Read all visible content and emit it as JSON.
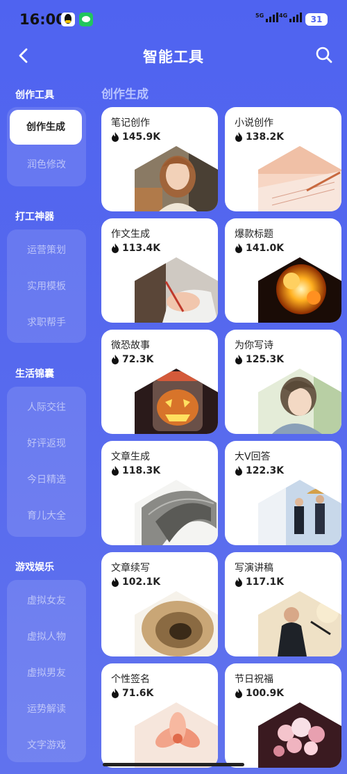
{
  "status": {
    "time": "16:00",
    "sig1_label": "5G",
    "sig2_label": "4G",
    "battery": "31"
  },
  "header": {
    "title": "智能工具"
  },
  "sidebar": {
    "sections": [
      {
        "title": "创作工具",
        "items": [
          "创作生成",
          "润色修改"
        ],
        "active": 0
      },
      {
        "title": "打工神器",
        "items": [
          "运营策划",
          "实用模板",
          "求职帮手"
        ]
      },
      {
        "title": "生活锦囊",
        "items": [
          "人际交往",
          "好评返现",
          "今日精选",
          "育儿大全"
        ]
      },
      {
        "title": "游戏娱乐",
        "items": [
          "虚拟女友",
          "虚拟人物",
          "虚拟男友",
          "运势解读",
          "文字游戏"
        ]
      }
    ]
  },
  "main": {
    "title": "创作生成",
    "cards": [
      {
        "title": "笔记创作",
        "count": "145.9K",
        "image": "portrait-woman"
      },
      {
        "title": "小说创作",
        "count": "138.2K",
        "image": "paper-pen"
      },
      {
        "title": "作文生成",
        "count": "113.4K",
        "image": "hand-writing"
      },
      {
        "title": "爆款标题",
        "count": "141.0K",
        "image": "explosion"
      },
      {
        "title": "微恐故事",
        "count": "72.3K",
        "image": "pumpkin-lantern"
      },
      {
        "title": "为你写诗",
        "count": "125.3K",
        "image": "anime-poet"
      },
      {
        "title": "文章生成",
        "count": "118.3K",
        "image": "paper-roll"
      },
      {
        "title": "大V回答",
        "count": "122.3K",
        "image": "business-people"
      },
      {
        "title": "文章续写",
        "count": "102.1K",
        "image": "book-tunnel"
      },
      {
        "title": "写演讲稿",
        "count": "117.1K",
        "image": "speaker"
      },
      {
        "title": "个性签名",
        "count": "71.6K",
        "image": "flower"
      },
      {
        "title": "节日祝福",
        "count": "100.9K",
        "image": "flowers-bouquet"
      }
    ]
  }
}
